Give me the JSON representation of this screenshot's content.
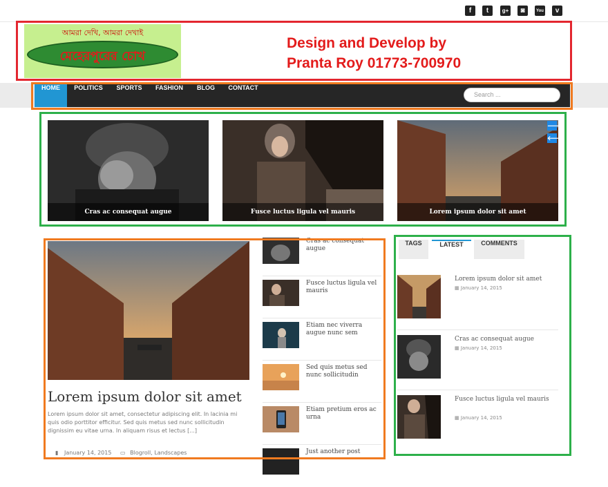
{
  "social": {
    "icons": [
      "facebook-icon",
      "twitter-icon",
      "google-plus-icon",
      "instagram-icon",
      "youtube-icon",
      "vimeo-icon"
    ],
    "glyphs": [
      "f",
      "t",
      "g+",
      "◙",
      "You",
      "v"
    ]
  },
  "header": {
    "logo_top_text": "আমরা দেখি, আমরা দেখাই",
    "logo_main_text": "মেহেরপুরের চোখ",
    "credit_line1": "Design and Develop by",
    "credit_line2": "Pranta Roy  01773-700970"
  },
  "nav": {
    "items": [
      "HOME",
      "POLITICS",
      "SPORTS",
      "FASHION",
      "BLOG",
      "CONTACT"
    ],
    "search_placeholder": "Search ..."
  },
  "slider": {
    "slides": [
      "Cras ac consequat augue",
      "Fusce luctus ligula vel mauris",
      "Lorem ipsum dolor sit amet"
    ],
    "next_glyph": "🡒",
    "prev_glyph": "🡐"
  },
  "featured": {
    "title": "Lorem ipsum dolor sit amet",
    "excerpt": "Lorem ipsum dolor sit amet, consectetur adipiscing elit. In lacinia mi quis odio porttitor efficitur. Sed quis metus sed nunc sollicitudin dignissim eu vitae urna. In aliquam risus et lectus [...]",
    "date": "January 14, 2015",
    "categories": "Blogroll, Landscapes"
  },
  "posts_list": [
    "Cras ac consequat augue",
    "Fusce luctus ligula vel mauris",
    "Etiam nec viverra augue nunc sem",
    "Sed quis metus sed nunc sollicitudin",
    "Etiam pretium eros ac urna",
    "Just another post"
  ],
  "sidebar": {
    "tabs": [
      "TAGS",
      "LATEST",
      "COMMENTS"
    ],
    "items": [
      {
        "title": "Lorem ipsum dolor sit amet",
        "date": "January 14, 2015"
      },
      {
        "title": "Cras ac consequat augue",
        "date": "January 14, 2015"
      },
      {
        "title": "Fusce luctus ligula vel mauris",
        "date": "January 14, 2015"
      }
    ]
  },
  "colors": {
    "nav_bg": "#262626",
    "accent": "#2196d3",
    "annotation_red": "#e3262f",
    "annotation_orange": "#f07a1f",
    "annotation_green": "#2db04a"
  }
}
